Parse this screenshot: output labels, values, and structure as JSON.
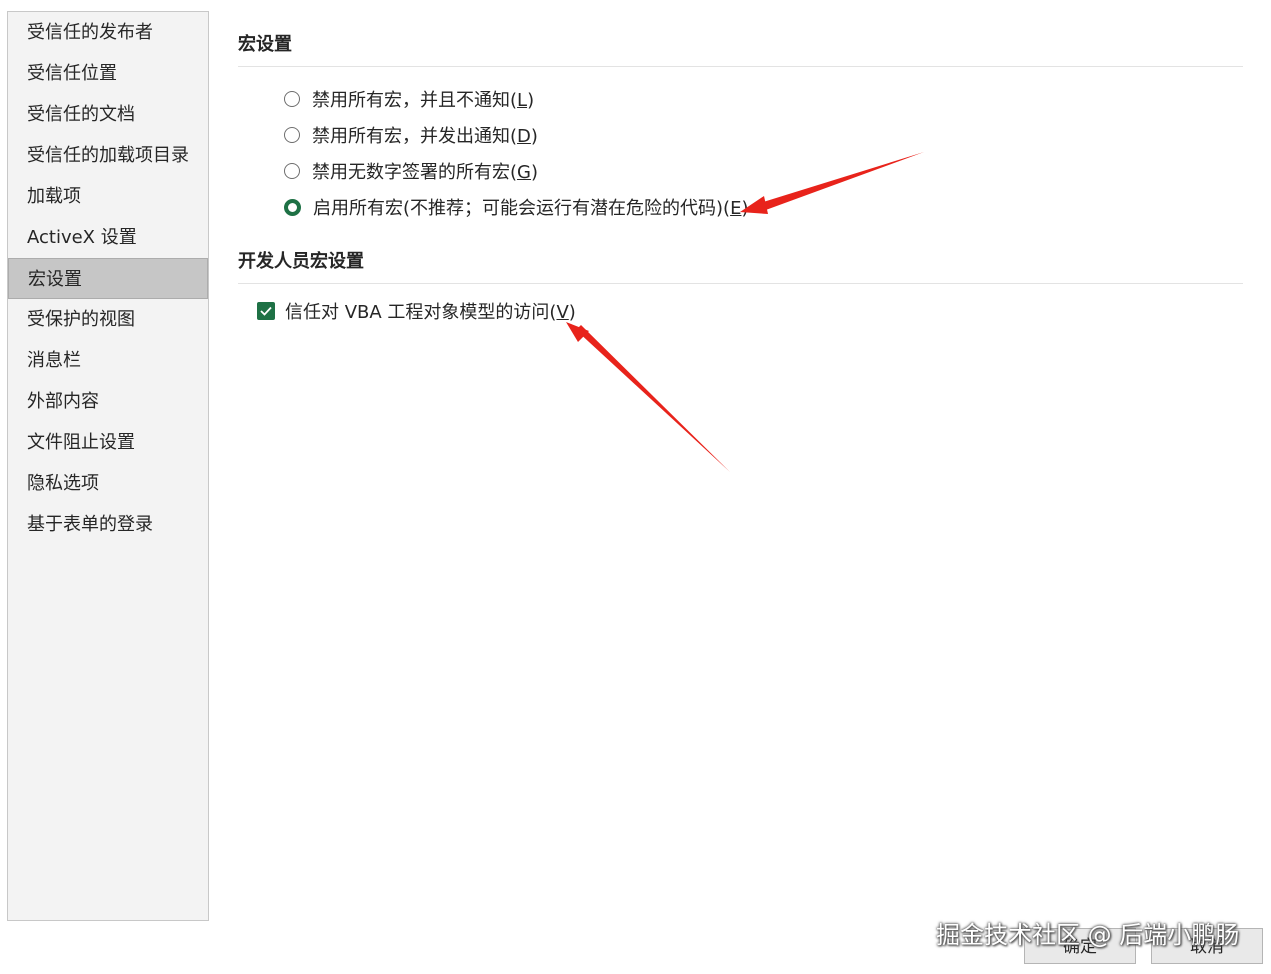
{
  "sidebar": {
    "items": [
      {
        "label": "受信任的发布者"
      },
      {
        "label": "受信任位置"
      },
      {
        "label": "受信任的文档"
      },
      {
        "label": "受信任的加载项目录"
      },
      {
        "label": "加载项"
      },
      {
        "label": "ActiveX 设置"
      },
      {
        "label": "宏设置",
        "selected": true
      },
      {
        "label": "受保护的视图"
      },
      {
        "label": "消息栏"
      },
      {
        "label": "外部内容"
      },
      {
        "label": "文件阻止设置"
      },
      {
        "label": "隐私选项"
      },
      {
        "label": "基于表单的登录"
      }
    ]
  },
  "macro_settings": {
    "title": "宏设置",
    "options": [
      {
        "text": "禁用所有宏，并且不通知(",
        "key": "L",
        "suffix": ")",
        "selected": false
      },
      {
        "text": "禁用所有宏，并发出通知(",
        "key": "D",
        "suffix": ")",
        "selected": false
      },
      {
        "text": "禁用无数字签署的所有宏(",
        "key": "G",
        "suffix": ")",
        "selected": false
      },
      {
        "text": "启用所有宏(不推荐；可能会运行有潜在危险的代码)(",
        "key": "E",
        "suffix": ")",
        "selected": true
      }
    ]
  },
  "developer_settings": {
    "title": "开发人员宏设置",
    "trust_vba": {
      "text": "信任对 VBA 工程对象模型的访问(",
      "key": "V",
      "suffix": ")",
      "checked": true
    }
  },
  "footer": {
    "ok_label": "确定",
    "cancel_label": "取消"
  },
  "watermark": "掘金技术社区 @ 后端小鹏肠",
  "colors": {
    "accent": "#1e7145",
    "arrow": "#e8231b",
    "sidebar_bg": "#f3f3f3",
    "selected_bg": "#c6c6c6"
  }
}
